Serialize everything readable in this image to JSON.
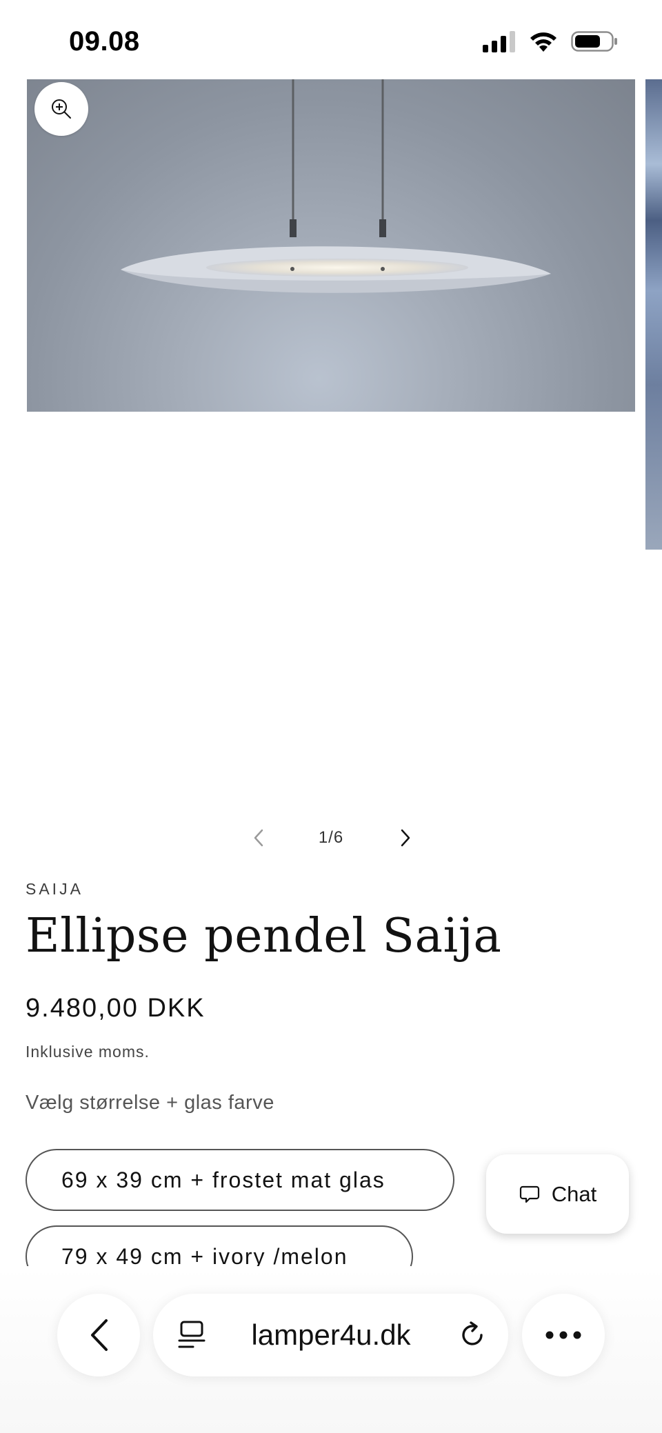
{
  "status_bar": {
    "time": "09.08",
    "icons": [
      "cellular-signal-icon",
      "wifi-icon",
      "battery-icon"
    ]
  },
  "gallery": {
    "counter": "1/6",
    "icons": {
      "zoom": "zoom-in-icon",
      "prev": "chevron-left-icon",
      "next": "chevron-right-icon"
    }
  },
  "product": {
    "vendor": "SAIJA",
    "title": "Ellipse pendel Saija",
    "price": "9.480,00 DKK",
    "tax_note": "Inklusive moms.",
    "variant_label": "Vælg størrelse + glas farve",
    "variants": [
      "69 x 39 cm + frostet mat glas",
      "79 x 49 cm + ivory /melon"
    ]
  },
  "chat": {
    "label": "Chat",
    "icon": "chat-bubble-icon"
  },
  "browser": {
    "url": "lamper4u.dk",
    "icons": {
      "back": "chevron-left-icon",
      "reader": "reader-mode-icon",
      "reload": "reload-icon",
      "more": "more-horizontal-icon"
    }
  },
  "colors": {
    "text": "#121212",
    "border": "#555555",
    "background": "#ffffff"
  }
}
